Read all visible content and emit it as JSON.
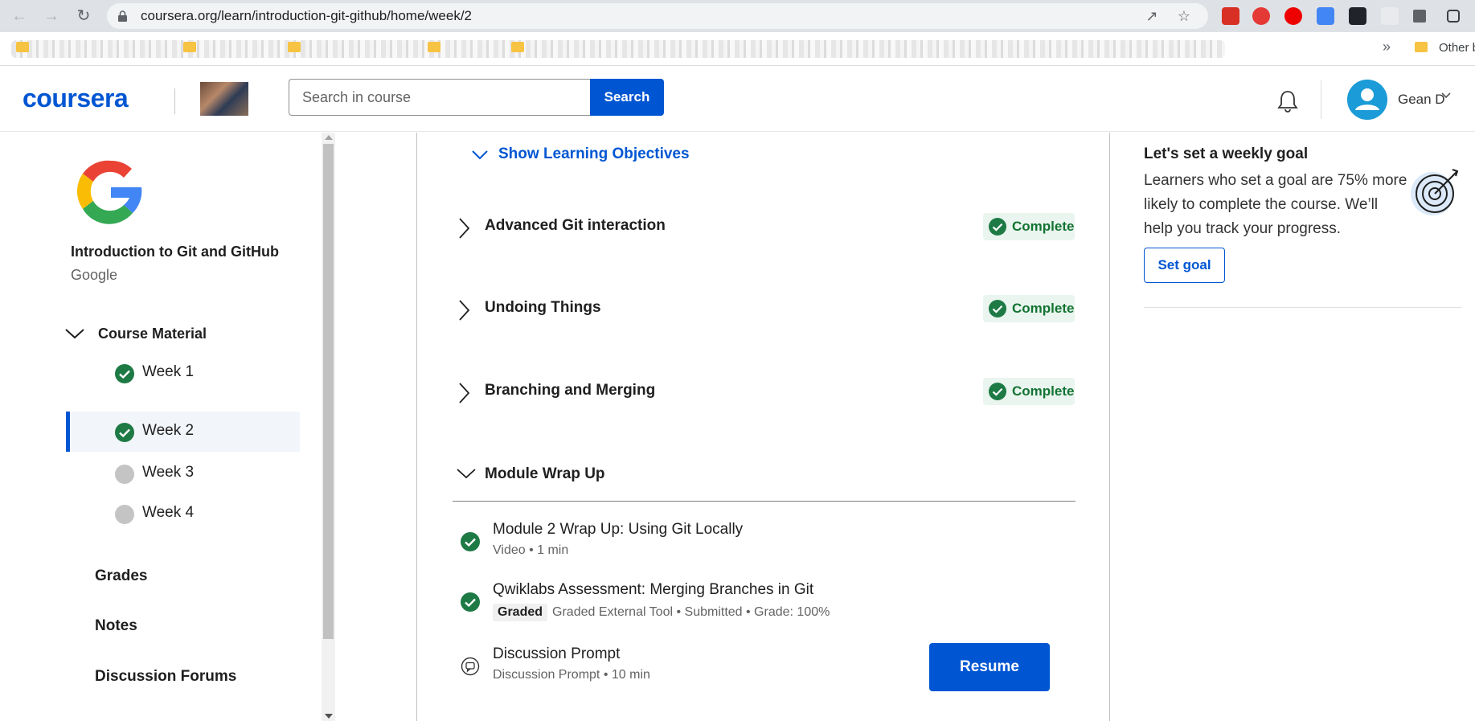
{
  "browser": {
    "url": "coursera.org/learn/introduction-git-github/home/week/2",
    "bookmarks_other": "Other b"
  },
  "header": {
    "logo": "coursera",
    "search_placeholder": "Search in course",
    "search_button": "Search",
    "user_name": "Gean D"
  },
  "sidebar": {
    "course_name": "Introduction to Git and GitHub",
    "course_org": "Google",
    "course_material": "Course Material",
    "weeks": [
      {
        "label": "Week 1",
        "status": "complete"
      },
      {
        "label": "Week 2",
        "status": "complete",
        "active": true
      },
      {
        "label": "Week 3",
        "status": "incomplete"
      },
      {
        "label": "Week 4",
        "status": "incomplete"
      }
    ],
    "links": [
      "Grades",
      "Notes",
      "Discussion Forums"
    ]
  },
  "main": {
    "objectives_toggle": "Show Learning Objectives",
    "lessons": [
      {
        "title": "Advanced Git interaction",
        "status": "Complete"
      },
      {
        "title": "Undoing Things",
        "status": "Complete"
      },
      {
        "title": "Branching and Merging",
        "status": "Complete"
      }
    ],
    "wrap_up": {
      "title": "Module Wrap Up",
      "items": [
        {
          "title": "Module 2 Wrap Up: Using Git Locally",
          "meta": "Video • 1 min"
        },
        {
          "title": "Qwiklabs Assessment: Merging Branches in Git",
          "tag": "Graded",
          "meta": "Graded External Tool • Submitted • Grade: 100%"
        },
        {
          "title": "Discussion Prompt",
          "meta": "Discussion Prompt • 10 min"
        }
      ],
      "resume_button": "Resume"
    }
  },
  "goal_panel": {
    "title": "Let's set a weekly goal",
    "text": "Learners who set a goal are 75% more likely to complete the course. We’ll help you track your progress.",
    "button": "Set goal"
  },
  "colors": {
    "brand": "#0056d2",
    "complete_green": "#1e7a45",
    "complete_bg": "#e9f5ee"
  }
}
